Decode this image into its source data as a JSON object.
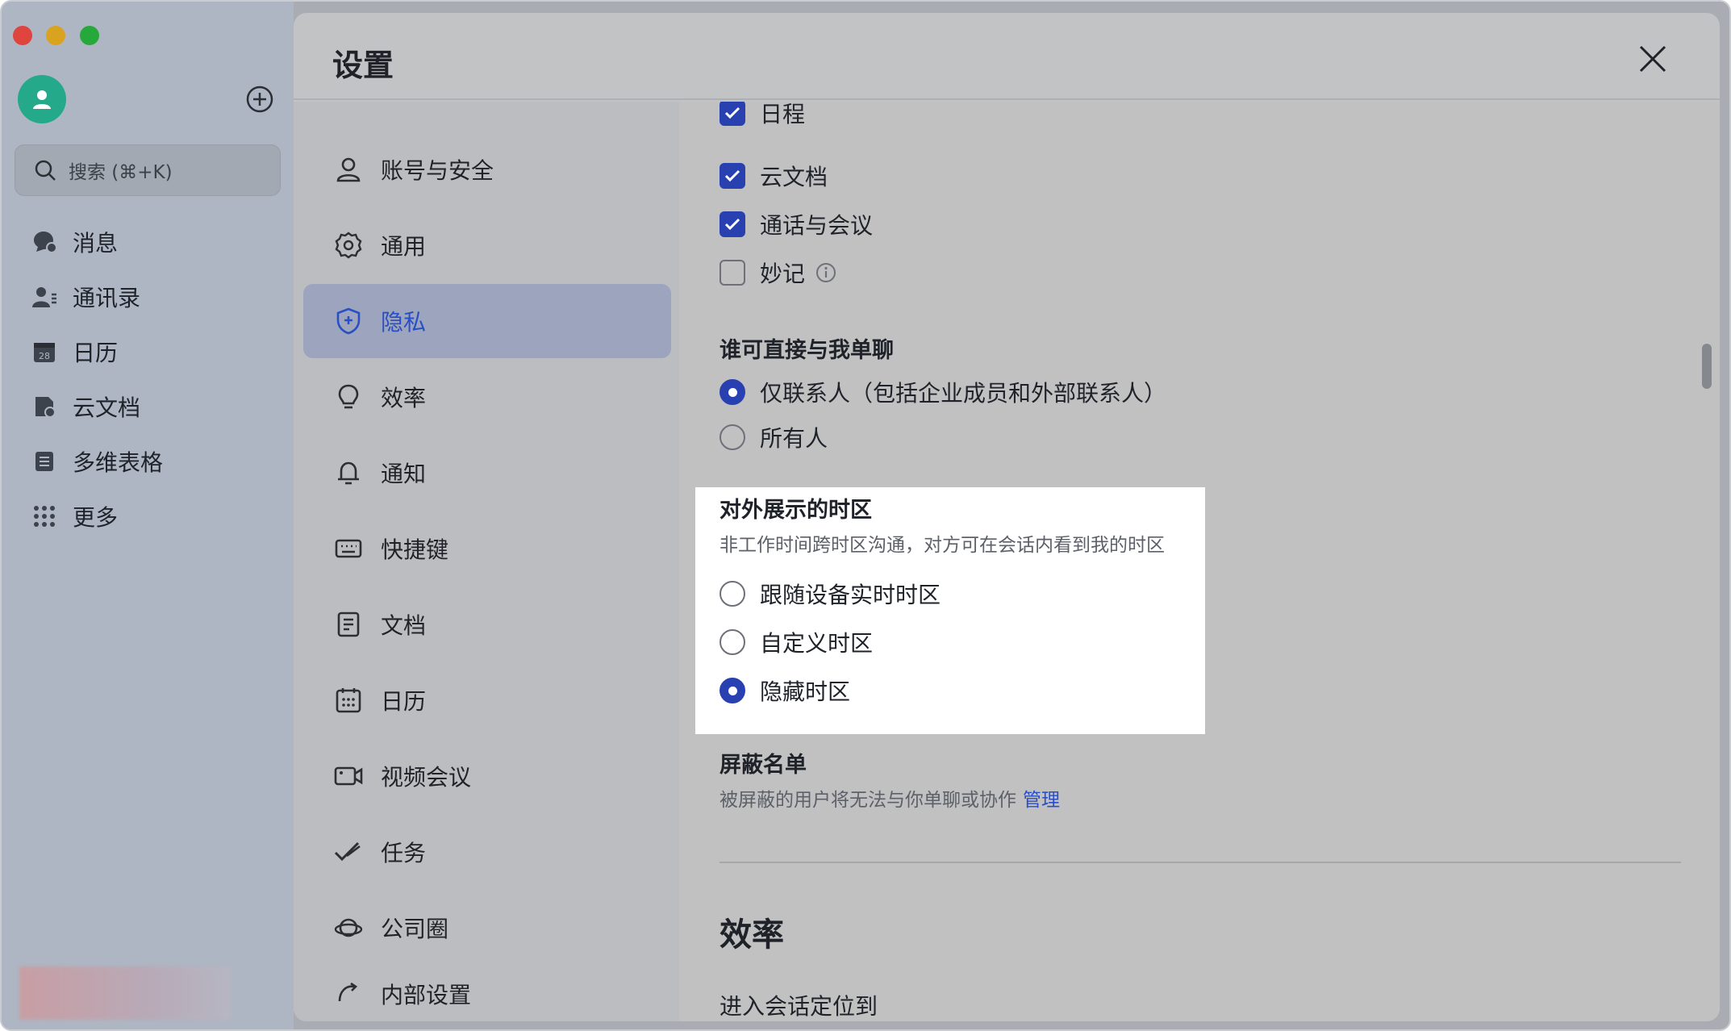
{
  "app": {
    "search_placeholder": "搜索 (⌘+K)",
    "nav": [
      {
        "label": "消息",
        "icon": "chat-bubble-icon"
      },
      {
        "label": "通讯录",
        "icon": "contacts-icon"
      },
      {
        "label": "日历",
        "icon": "calendar-icon",
        "badge": "28"
      },
      {
        "label": "云文档",
        "icon": "cloud-doc-icon"
      },
      {
        "label": "多维表格",
        "icon": "base-table-icon"
      },
      {
        "label": "更多",
        "icon": "grid-more-icon"
      }
    ]
  },
  "settings": {
    "title": "设置",
    "nav": [
      {
        "label": "账号与安全",
        "icon": "user-icon"
      },
      {
        "label": "通用",
        "icon": "gear-icon"
      },
      {
        "label": "隐私",
        "icon": "shield-icon",
        "active": true
      },
      {
        "label": "效率",
        "icon": "lightbulb-icon"
      },
      {
        "label": "通知",
        "icon": "bell-icon"
      },
      {
        "label": "快捷键",
        "icon": "keyboard-icon"
      },
      {
        "label": "文档",
        "icon": "document-icon"
      },
      {
        "label": "日历",
        "icon": "calendar-icon"
      },
      {
        "label": "视频会议",
        "icon": "video-icon"
      },
      {
        "label": "任务",
        "icon": "task-check-icon"
      },
      {
        "label": "公司圈",
        "icon": "planet-icon"
      },
      {
        "label": "内部设置",
        "icon": "internal-settings-icon"
      }
    ],
    "checkboxes": [
      {
        "label": "日程",
        "checked": true
      },
      {
        "label": "云文档",
        "checked": true
      },
      {
        "label": "通话与会议",
        "checked": true
      },
      {
        "label": "妙记",
        "checked": false
      }
    ],
    "direct_chat": {
      "title": "谁可直接与我单聊",
      "options": [
        {
          "label": "仅联系人（包括企业成员和外部联系人）",
          "selected": true
        },
        {
          "label": "所有人",
          "selected": false
        }
      ]
    },
    "timezone": {
      "title": "对外展示的时区",
      "desc": "非工作时间跨时区沟通，对方可在会话内看到我的时区",
      "options": [
        {
          "label": "跟随设备实时时区",
          "selected": false
        },
        {
          "label": "自定义时区",
          "selected": false
        },
        {
          "label": "隐藏时区",
          "selected": true
        }
      ]
    },
    "blocklist": {
      "title": "屏蔽名单",
      "desc": "被屏蔽的用户将无法与你单聊或协作",
      "link": "管理"
    },
    "efficiency": {
      "title": "效率",
      "subtitle": "进入会话定位到"
    }
  },
  "colors": {
    "accent": "#2940b0",
    "avatar": "#24a98a",
    "active_nav_bg": "#9ca5bd"
  }
}
